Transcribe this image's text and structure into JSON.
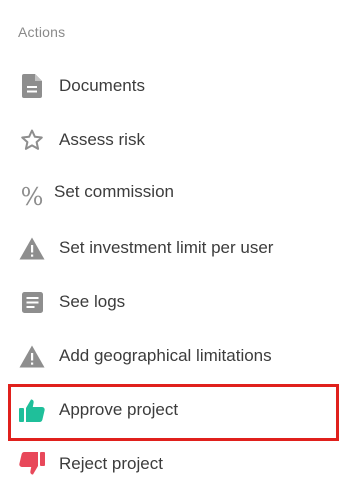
{
  "section": {
    "title": "Actions"
  },
  "actions": [
    {
      "label": "Documents",
      "icon": "document-icon"
    },
    {
      "label": "Assess risk",
      "icon": "star-icon"
    },
    {
      "label": "Set commission",
      "icon": "percent-icon"
    },
    {
      "label": "Set investment limit per user",
      "icon": "warning-icon"
    },
    {
      "label": "See logs",
      "icon": "logs-icon"
    },
    {
      "label": "Add geographical limitations",
      "icon": "warning-icon"
    },
    {
      "label": "Approve project",
      "icon": "thumbs-up-icon",
      "highlighted": true
    },
    {
      "label": "Reject project",
      "icon": "thumbs-down-icon"
    }
  ],
  "colors": {
    "icon_gray": "#8e8e8e",
    "approve": "#1fbf9a",
    "reject": "#e8485a",
    "highlight_border": "#e0201c"
  }
}
